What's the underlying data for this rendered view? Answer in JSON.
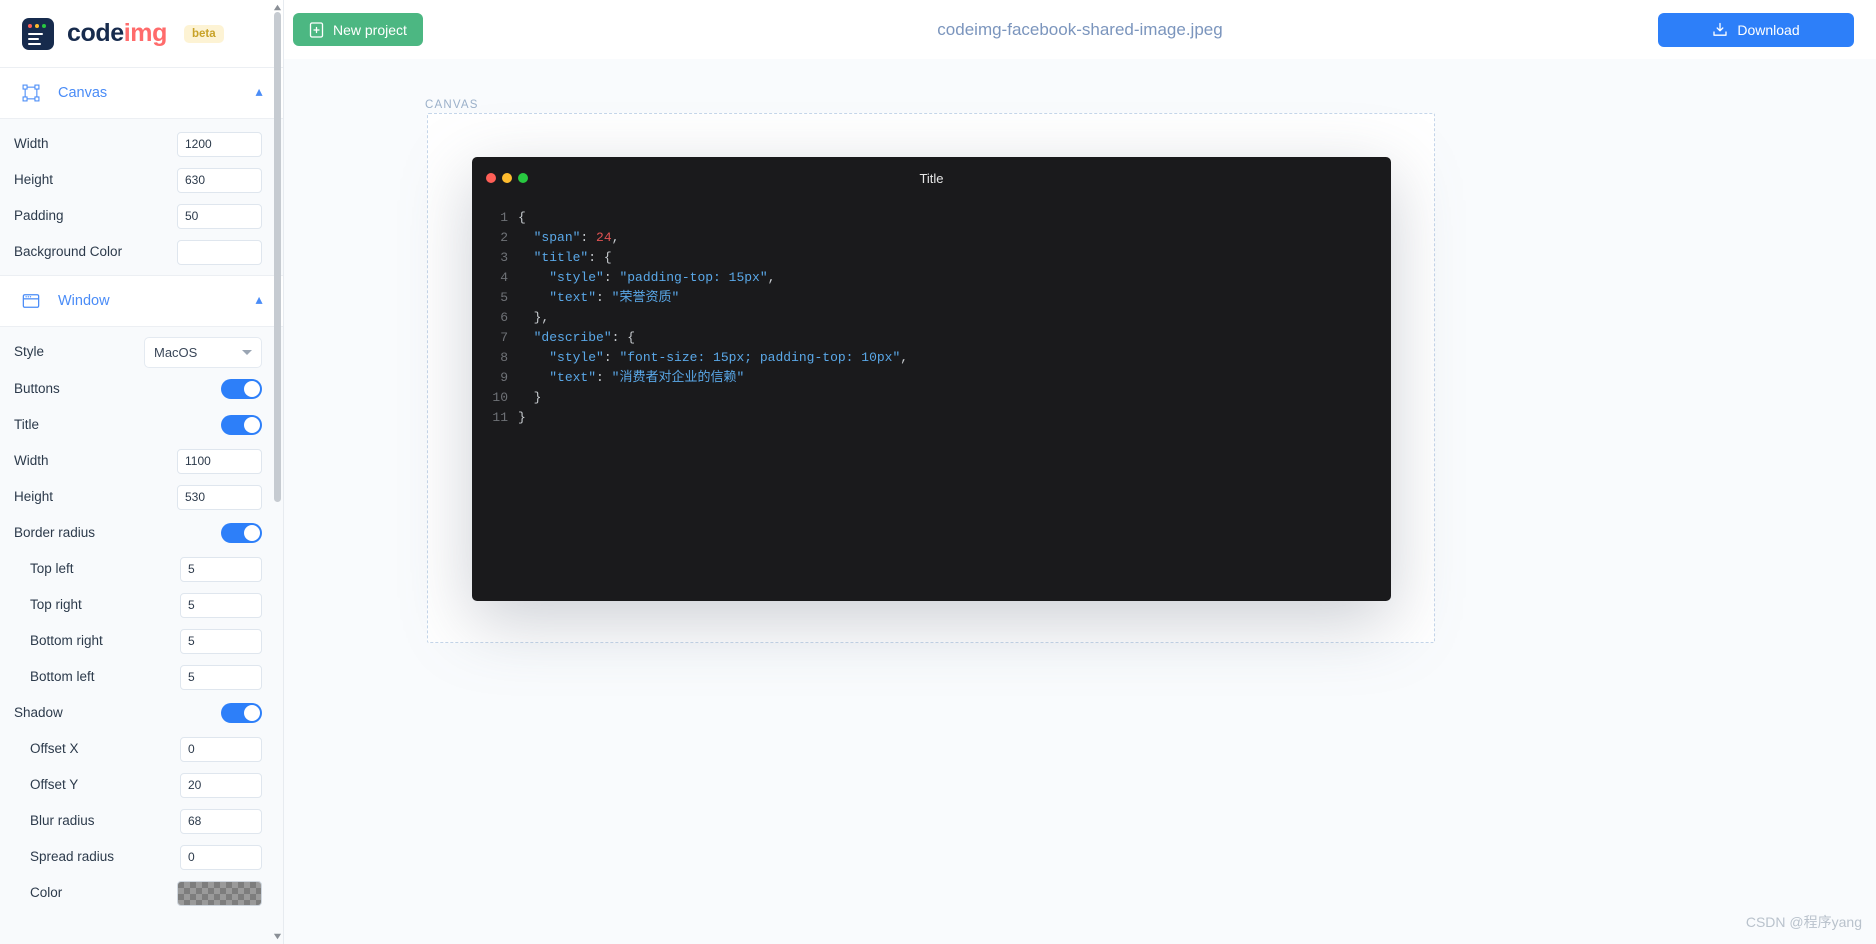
{
  "brand": {
    "name_part1": "code",
    "name_part2": "img",
    "badge": "beta",
    "logo_icon": "codeimg-logo-icon"
  },
  "topbar": {
    "new_project_label": "New project",
    "new_project_icon": "file-plus-icon",
    "document_title": "codeimg-facebook-shared-image.jpeg",
    "download_label": "Download",
    "download_icon": "download-icon",
    "accent_green": "#4cb782",
    "accent_blue": "#2d7ff9"
  },
  "sidebar": {
    "sections": [
      {
        "id": "canvas",
        "title": "Canvas",
        "icon": "canvas-frame-icon",
        "collapse_icon": "chevron-up-icon",
        "fields": [
          {
            "type": "number",
            "label": "Width",
            "value": "1200",
            "name": "canvas-width-input"
          },
          {
            "type": "number",
            "label": "Height",
            "value": "630",
            "name": "canvas-height-input"
          },
          {
            "type": "number",
            "label": "Padding",
            "value": "50",
            "name": "canvas-padding-input"
          },
          {
            "type": "color",
            "label": "Background Color",
            "value": "",
            "name": "canvas-background-color-input"
          }
        ]
      },
      {
        "id": "window",
        "title": "Window",
        "icon": "window-icon",
        "collapse_icon": "chevron-up-icon",
        "fields": [
          {
            "type": "select",
            "label": "Style",
            "value": "MacOS",
            "name": "window-style-select"
          },
          {
            "type": "toggle",
            "label": "Buttons",
            "value": "on",
            "name": "window-buttons-toggle"
          },
          {
            "type": "toggle",
            "label": "Title",
            "value": "on",
            "name": "window-title-toggle"
          },
          {
            "type": "number",
            "label": "Width",
            "value": "1100",
            "name": "window-width-input"
          },
          {
            "type": "number",
            "label": "Height",
            "value": "530",
            "name": "window-height-input"
          },
          {
            "type": "toggle",
            "label": "Border radius",
            "value": "on",
            "name": "border-radius-toggle"
          },
          {
            "type": "number",
            "label": "Top left",
            "value": "5",
            "indent": true,
            "name": "radius-top-left-input"
          },
          {
            "type": "number",
            "label": "Top right",
            "value": "5",
            "indent": true,
            "name": "radius-top-right-input"
          },
          {
            "type": "number",
            "label": "Bottom right",
            "value": "5",
            "indent": true,
            "name": "radius-bottom-right-input"
          },
          {
            "type": "number",
            "label": "Bottom left",
            "value": "5",
            "indent": true,
            "name": "radius-bottom-left-input"
          },
          {
            "type": "toggle",
            "label": "Shadow",
            "value": "on",
            "name": "shadow-toggle"
          },
          {
            "type": "number",
            "label": "Offset X",
            "value": "0",
            "indent": true,
            "name": "shadow-offset-x-input"
          },
          {
            "type": "number",
            "label": "Offset Y",
            "value": "20",
            "indent": true,
            "name": "shadow-offset-y-input"
          },
          {
            "type": "number",
            "label": "Blur radius",
            "value": "68",
            "indent": true,
            "name": "shadow-blur-radius-input"
          },
          {
            "type": "number",
            "label": "Spread radius",
            "value": "0",
            "indent": true,
            "name": "shadow-spread-radius-input"
          },
          {
            "type": "checker",
            "label": "Color",
            "value": "",
            "indent": true,
            "name": "shadow-color-input"
          }
        ]
      }
    ]
  },
  "workspace": {
    "canvas_label": "CANVAS",
    "window": {
      "title": "Title",
      "traffic_lights": [
        "close-button-red",
        "minimize-button-yellow",
        "maximize-button-green"
      ],
      "code_lines": [
        {
          "n": "1",
          "tokens": [
            {
              "t": "punc",
              "v": "{"
            }
          ]
        },
        {
          "n": "2",
          "tokens": [
            {
              "t": "plain",
              "v": "  "
            },
            {
              "t": "key",
              "v": "\"span\""
            },
            {
              "t": "punc",
              "v": ": "
            },
            {
              "t": "num",
              "v": "24"
            },
            {
              "t": "punc",
              "v": ","
            }
          ]
        },
        {
          "n": "3",
          "tokens": [
            {
              "t": "plain",
              "v": "  "
            },
            {
              "t": "key",
              "v": "\"title\""
            },
            {
              "t": "punc",
              "v": ": {"
            }
          ]
        },
        {
          "n": "4",
          "tokens": [
            {
              "t": "plain",
              "v": "    "
            },
            {
              "t": "key",
              "v": "\"style\""
            },
            {
              "t": "punc",
              "v": ": "
            },
            {
              "t": "str",
              "v": "\"padding-top: 15px\""
            },
            {
              "t": "punc",
              "v": ","
            }
          ]
        },
        {
          "n": "5",
          "tokens": [
            {
              "t": "plain",
              "v": "    "
            },
            {
              "t": "key",
              "v": "\"text\""
            },
            {
              "t": "punc",
              "v": ": "
            },
            {
              "t": "str",
              "v": "\"荣誉资质\""
            }
          ]
        },
        {
          "n": "6",
          "tokens": [
            {
              "t": "plain",
              "v": "  "
            },
            {
              "t": "punc",
              "v": "},"
            }
          ]
        },
        {
          "n": "7",
          "tokens": [
            {
              "t": "plain",
              "v": "  "
            },
            {
              "t": "key",
              "v": "\"describe\""
            },
            {
              "t": "punc",
              "v": ": {"
            }
          ]
        },
        {
          "n": "8",
          "tokens": [
            {
              "t": "plain",
              "v": "    "
            },
            {
              "t": "key",
              "v": "\"style\""
            },
            {
              "t": "punc",
              "v": ": "
            },
            {
              "t": "str",
              "v": "\"font-size: 15px; padding-top: 10px\""
            },
            {
              "t": "punc",
              "v": ","
            }
          ]
        },
        {
          "n": "9",
          "tokens": [
            {
              "t": "plain",
              "v": "    "
            },
            {
              "t": "key",
              "v": "\"text\""
            },
            {
              "t": "punc",
              "v": ": "
            },
            {
              "t": "str",
              "v": "\"消费者对企业的信赖\""
            }
          ]
        },
        {
          "n": "10",
          "tokens": [
            {
              "t": "plain",
              "v": "  "
            },
            {
              "t": "punc",
              "v": "}"
            }
          ]
        },
        {
          "n": "11",
          "tokens": [
            {
              "t": "punc",
              "v": "}"
            }
          ]
        }
      ]
    }
  },
  "watermark": "CSDN @程序yang"
}
